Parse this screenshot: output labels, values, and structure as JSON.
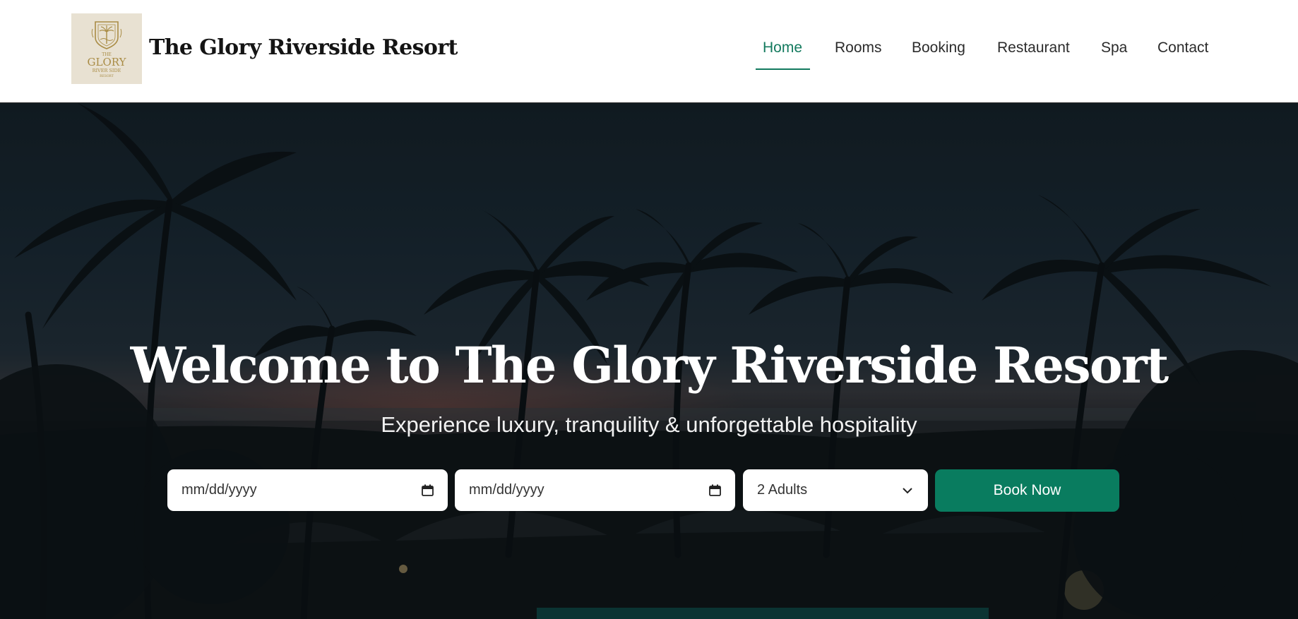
{
  "brand": {
    "name": "The Glory Riverside Resort",
    "logo_text_top": "THE",
    "logo_text_main": "GLORY",
    "logo_text_sub": "RIVER SIDE",
    "logo_text_bottom": "RESORT",
    "logo_bg": "#e8e1d2",
    "logo_color": "#a98c45"
  },
  "nav": {
    "items": [
      {
        "label": "Home",
        "active": true
      },
      {
        "label": "Rooms",
        "active": false
      },
      {
        "label": "Booking",
        "active": false
      },
      {
        "label": "Restaurant",
        "active": false
      },
      {
        "label": "Spa",
        "active": false
      },
      {
        "label": "Contact",
        "active": false
      }
    ]
  },
  "hero": {
    "title": "Welcome to The Glory Riverside Resort",
    "subtitle": "Experience luxury, tranquility & unforgettable hospitality"
  },
  "booking": {
    "checkin_value": "mm/dd/yyyy",
    "checkout_value": "mm/dd/yyyy",
    "guests_value": "2 Adults",
    "button_label": "Book Now",
    "checkin_icon": "calendar-icon",
    "checkout_icon": "calendar-icon",
    "guests_icon": "chevron-down-icon"
  },
  "colors": {
    "accent": "#137a5e",
    "button": "#097c5f",
    "header_bg": "#ffffff"
  }
}
